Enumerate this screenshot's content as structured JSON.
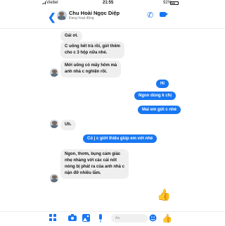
{
  "status_bar": {
    "carrier": "Viettel",
    "time": "21:55",
    "battery": "92%"
  },
  "header": {
    "back_icon": "chevron-left-icon",
    "name": "Chu Hoài Ngọc Diệp",
    "status": "Đang hoạt động",
    "call_icon": "phone-icon",
    "video_icon": "video-camera-icon"
  },
  "messages": {
    "m1": "Gái ơi.",
    "m2": "C uống hết trà rồi, gửi thêm\ncho c 3 hộp nữa nhé.",
    "m3": "Mới uống có mấy hôm mà\nanh nhà c nghiện rồi.",
    "o1": "Hi",
    "o2": "Ngon dùng k chị",
    "o3": "Mai em gửi c nhé",
    "m4": "Uh.",
    "o4": "Có j c giới thiệu giúp em với nhé",
    "m5": "Ngon, thơm, bụng cảm giác\nnhẹ nhàng với các cái nốt\nnóng bị phát ra của anh nhà c\nnặn đỡ nhiều lắm."
  },
  "input_bar": {
    "placeholder": "Aa",
    "icons": [
      "apps-icon",
      "camera-icon",
      "image-icon",
      "microphone-icon",
      "emoji-icon",
      "thumbs-up-icon"
    ]
  },
  "colors": {
    "accent": "#1877f2",
    "incoming_bubble": "#efefef"
  }
}
